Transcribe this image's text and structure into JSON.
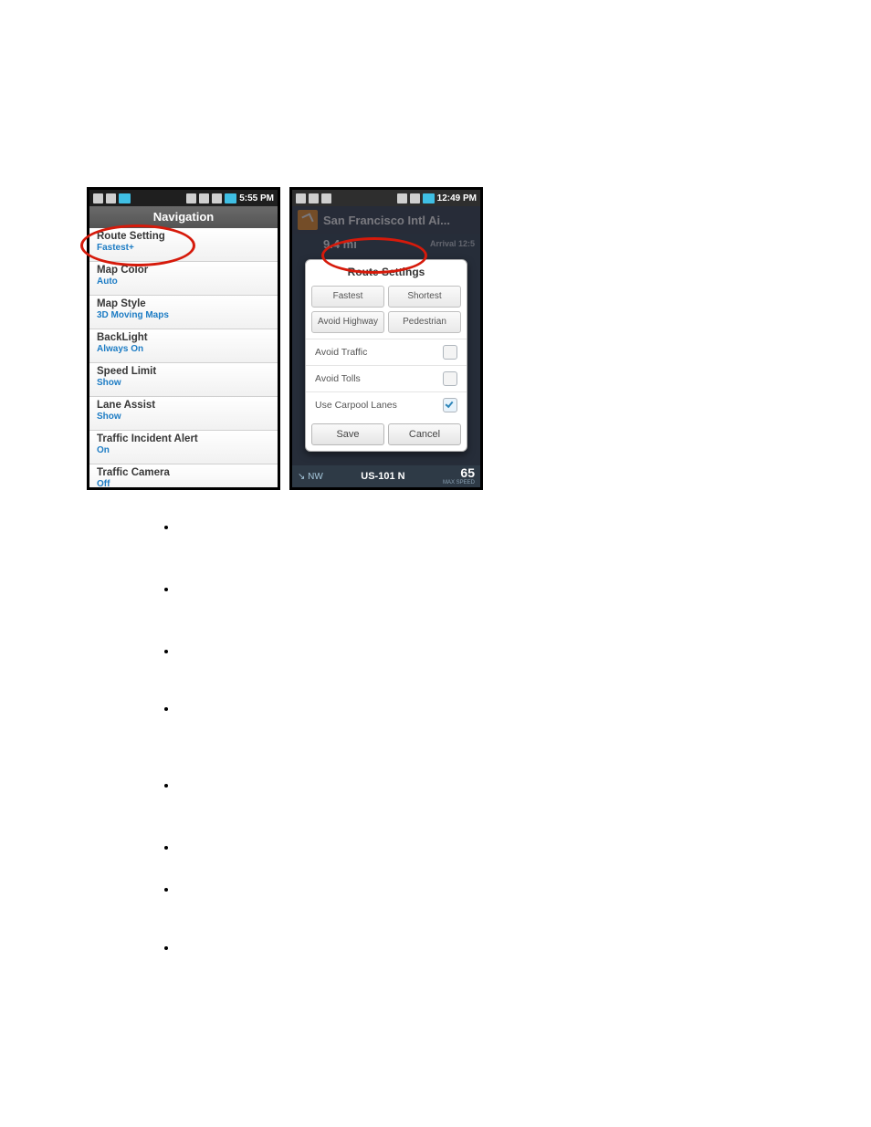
{
  "left_phone": {
    "status_time": "5:55 PM",
    "title": "Navigation",
    "rows": [
      {
        "label": "Route Setting",
        "value": "Fastest+"
      },
      {
        "label": "Map Color",
        "value": "Auto"
      },
      {
        "label": "Map Style",
        "value": "3D Moving Maps"
      },
      {
        "label": "BackLight",
        "value": "Always On"
      },
      {
        "label": "Speed Limit",
        "value": "Show"
      },
      {
        "label": "Lane Assist",
        "value": "Show"
      },
      {
        "label": "Traffic Incident Alert",
        "value": "On"
      },
      {
        "label": "Traffic Camera",
        "value": "Off"
      }
    ]
  },
  "right_phone": {
    "status_time": "12:49 PM",
    "destination": "San Francisco Intl Ai...",
    "distance": "9.4 mi",
    "arrival_label": "Arrival 12:5",
    "modal_title": "Route Settings",
    "seg1a": "Fastest",
    "seg1b": "Shortest",
    "seg2a": "Avoid Highway",
    "seg2b": "Pedestrian",
    "check1": "Avoid Traffic",
    "check2": "Avoid Tolls",
    "check3": "Use Carpool Lanes",
    "save": "Save",
    "cancel": "Cancel",
    "footer_dir": "NW",
    "footer_road": "US-101 N",
    "footer_speed": "65",
    "footer_speed_label": "MAX SPEED"
  }
}
